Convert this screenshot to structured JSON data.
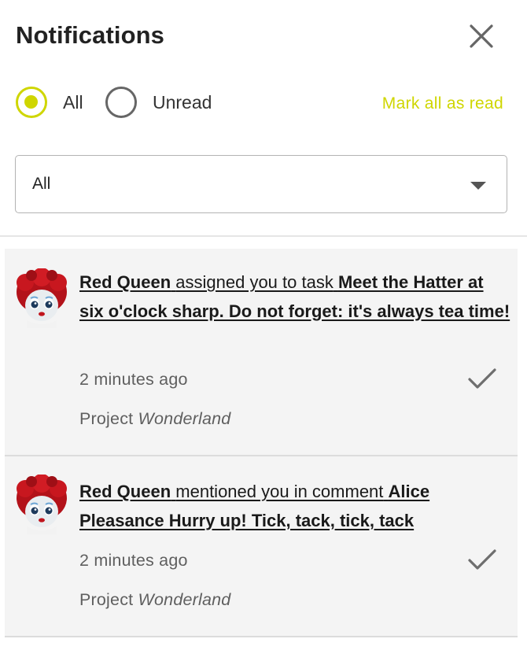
{
  "header": {
    "title": "Notifications",
    "close_icon": "close-icon"
  },
  "filters": {
    "all_label": "All",
    "unread_label": "Unread",
    "selected": "All",
    "mark_all_read": "Mark all as read"
  },
  "type_select": {
    "value": "All"
  },
  "colors": {
    "accent": "#cfd600",
    "card_bg": "#f4f4f4",
    "muted_text": "#5f5f5f"
  },
  "notifications": [
    {
      "user": "Red Queen",
      "action": "assigned you to task",
      "target": "Meet the Hatter at six o'clock sharp. Do not forget: it's always tea time!",
      "time": "2 minutes ago",
      "project_prefix": "Project",
      "project_name": "Wonderland",
      "avatar_icon": "red-queen-avatar",
      "check_icon": "checkmark-icon"
    },
    {
      "user": "Red Queen",
      "action": "mentioned you in comment",
      "target": "Alice Pleasance Hurry up! Tick, tack, tick, tack",
      "time": "2 minutes ago",
      "project_prefix": "Project",
      "project_name": "Wonderland",
      "avatar_icon": "red-queen-avatar",
      "check_icon": "checkmark-icon"
    }
  ]
}
